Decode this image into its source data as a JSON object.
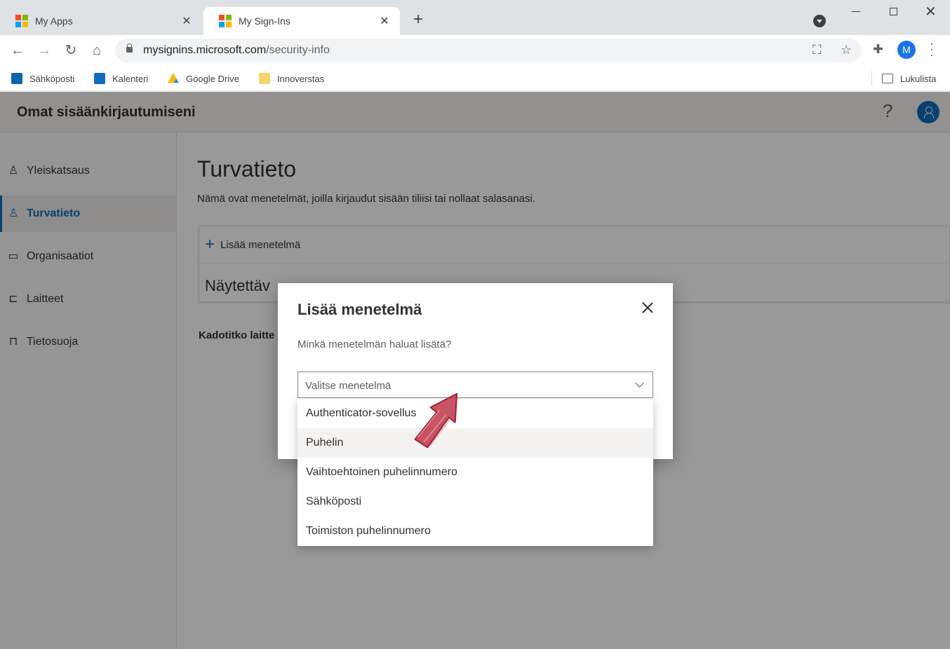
{
  "browser": {
    "tabs": [
      {
        "title": "My Apps"
      },
      {
        "title": "My Sign-Ins"
      }
    ],
    "url_host": "mysignins.microsoft.com",
    "url_path": "/security-info",
    "profile_initial": "M",
    "bookmarks": [
      "Sähköposti",
      "Kalenteri",
      "Google Drive",
      "Innoverstas"
    ],
    "reading_list": "Lukulista"
  },
  "app": {
    "title": "Omat sisäänkirjautumiseni",
    "help": "?"
  },
  "sidebar": {
    "items": [
      {
        "label": "Yleiskatsaus",
        "icon": "person-icon"
      },
      {
        "label": "Turvatieto",
        "icon": "security-info-icon"
      },
      {
        "label": "Organisaatiot",
        "icon": "briefcase-icon"
      },
      {
        "label": "Laitteet",
        "icon": "laptop-icon"
      },
      {
        "label": "Tietosuoja",
        "icon": "lock-icon"
      }
    ],
    "selected": "Turvatieto"
  },
  "main": {
    "title": "Turvatieto",
    "description": "Nämä ovat menetelmät, joilla kirjaudut sisään tiliisi tai nollaat salasanasi.",
    "add_method": "Lisää menetelmä",
    "card_subtitle_visible": "Näytettäv",
    "lost_device_visible": "Kadotitko laitte"
  },
  "dialog": {
    "title": "Lisää menetelmä",
    "question": "Minkä menetelmän haluat lisätä?",
    "select_placeholder": "Valitse menetelmä",
    "options": [
      "Authenticator-sovellus",
      "Puhelin",
      "Vaihtoehtoinen puhelinnumero",
      "Sähköposti",
      "Toimiston puhelinnumero"
    ],
    "highlighted_option": "Puhelin"
  },
  "colors": {
    "accent": "#0f6cbd",
    "annotation_arrow": "#c0364a"
  }
}
